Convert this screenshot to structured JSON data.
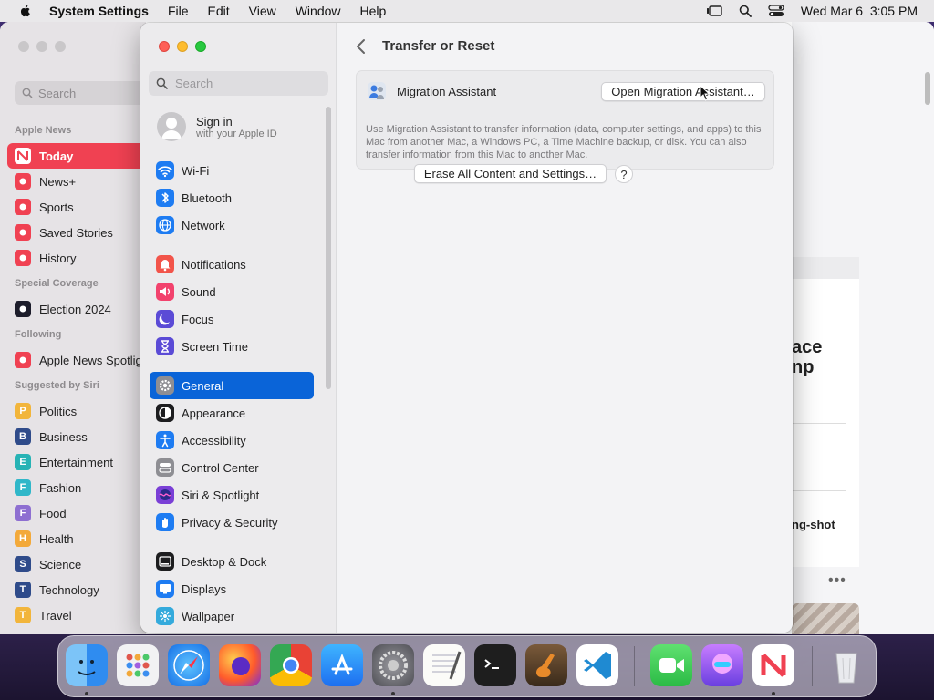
{
  "menubar": {
    "app_name": "System Settings",
    "menus": [
      "File",
      "Edit",
      "View",
      "Window",
      "Help"
    ],
    "datetime": "Wed Mar 6  3:05 PM"
  },
  "news": {
    "search_placeholder": "Search",
    "sections": [
      {
        "title": "Apple News",
        "items": [
          {
            "label": "Today",
            "icon": "news-icon",
            "color": "#f04152",
            "active": true
          },
          {
            "label": "News+",
            "icon": "news-plus-icon",
            "color": "#f04152"
          },
          {
            "label": "Sports",
            "icon": "sports-icon",
            "color": "#f04152"
          },
          {
            "label": "Saved Stories",
            "icon": "bookmark-icon",
            "color": "#f04152"
          },
          {
            "label": "History",
            "icon": "clock-icon",
            "color": "#f04152"
          }
        ]
      },
      {
        "title": "Special Coverage",
        "items": [
          {
            "label": "Election 2024",
            "icon": "election-icon",
            "color": "#1d1d2b"
          }
        ]
      },
      {
        "title": "Following",
        "items": [
          {
            "label": "Apple News Spotlight",
            "icon": "spotlight-icon",
            "color": "#f04152"
          }
        ]
      },
      {
        "title": "Suggested by Siri",
        "items": [
          {
            "label": "Politics",
            "letter": "P",
            "color": "#f2b53b"
          },
          {
            "label": "Business",
            "letter": "B",
            "color": "#2f4b8a"
          },
          {
            "label": "Entertainment",
            "letter": "E",
            "color": "#27b3b5"
          },
          {
            "label": "Fashion",
            "letter": "F",
            "color": "#30b7c9"
          },
          {
            "label": "Food",
            "letter": "F",
            "color": "#8e6fd1"
          },
          {
            "label": "Health",
            "letter": "H",
            "color": "#f3a93a"
          },
          {
            "label": "Science",
            "letter": "S",
            "color": "#2f4b8a"
          },
          {
            "label": "Technology",
            "letter": "T",
            "color": "#2f4b8a"
          },
          {
            "label": "Travel",
            "letter": "T",
            "color": "#f2b53b"
          }
        ]
      }
    ],
    "headline_fragment_1": "ace",
    "headline_fragment_2": "np",
    "story_fragment": "ng-shot",
    "more_dots": "•••"
  },
  "settings": {
    "search_placeholder": "Search",
    "signin_title": "Sign in",
    "signin_subtitle": "with your Apple ID",
    "groups": [
      [
        {
          "label": "Wi-Fi",
          "icon": "wifi-icon",
          "color": "#1e7cf2"
        },
        {
          "label": "Bluetooth",
          "icon": "bluetooth-icon",
          "color": "#1e7cf2"
        },
        {
          "label": "Network",
          "icon": "globe-icon",
          "color": "#1e7cf2"
        }
      ],
      [
        {
          "label": "Notifications",
          "icon": "bell-icon",
          "color": "#f2544a"
        },
        {
          "label": "Sound",
          "icon": "speaker-icon",
          "color": "#f2426d"
        },
        {
          "label": "Focus",
          "icon": "moon-icon",
          "color": "#5b4bd6"
        },
        {
          "label": "Screen Time",
          "icon": "hourglass-icon",
          "color": "#5b4bd6"
        }
      ],
      [
        {
          "label": "General",
          "icon": "gear-icon",
          "color": "#8e8e93",
          "active": true
        },
        {
          "label": "Appearance",
          "icon": "appearance-icon",
          "color": "#1d1d1f"
        },
        {
          "label": "Accessibility",
          "icon": "accessibility-icon",
          "color": "#1e7cf2"
        },
        {
          "label": "Control Center",
          "icon": "control-center-icon",
          "color": "#8e8e93"
        },
        {
          "label": "Siri & Spotlight",
          "icon": "siri-icon",
          "color": "#7a3fd6"
        },
        {
          "label": "Privacy & Security",
          "icon": "hand-icon",
          "color": "#1e7cf2"
        }
      ],
      [
        {
          "label": "Desktop & Dock",
          "icon": "dock-icon",
          "color": "#1d1d1f"
        },
        {
          "label": "Displays",
          "icon": "display-icon",
          "color": "#1e7cf2"
        },
        {
          "label": "Wallpaper",
          "icon": "wallpaper-icon",
          "color": "#34aadc"
        }
      ]
    ],
    "content": {
      "title": "Transfer or Reset",
      "migration_label": "Migration Assistant",
      "open_button": "Open Migration Assistant…",
      "description": "Use Migration Assistant to transfer information (data, computer settings, and apps) to this Mac from another Mac, a Windows PC, a Time Machine backup, or disk. You can also transfer information from this Mac to another Mac.",
      "erase_button": "Erase All Content and Settings…",
      "help_button": "?"
    }
  },
  "dock": {
    "apps": [
      {
        "name": "Finder",
        "icon": "finder-icon",
        "running": true
      },
      {
        "name": "Launchpad",
        "icon": "launchpad-icon"
      },
      {
        "name": "Safari",
        "icon": "safari-icon"
      },
      {
        "name": "Firefox",
        "icon": "firefox-icon"
      },
      {
        "name": "Chrome",
        "icon": "chrome-icon"
      },
      {
        "name": "App Store",
        "icon": "app-store-icon"
      },
      {
        "name": "System Settings",
        "icon": "system-settings-icon",
        "running": true
      },
      {
        "name": "TextEdit",
        "icon": "textedit-icon"
      },
      {
        "name": "Terminal",
        "icon": "terminal-icon"
      },
      {
        "name": "GarageBand",
        "icon": "garageband-icon"
      },
      {
        "name": "Visual Studio Code",
        "icon": "vscode-icon"
      },
      {
        "name": "FaceTime",
        "icon": "facetime-icon"
      },
      {
        "name": "Mastodon",
        "icon": "alien-app-icon"
      },
      {
        "name": "News",
        "icon": "news-app-icon",
        "running": true
      },
      {
        "name": "Trash",
        "icon": "trash-icon"
      }
    ]
  }
}
